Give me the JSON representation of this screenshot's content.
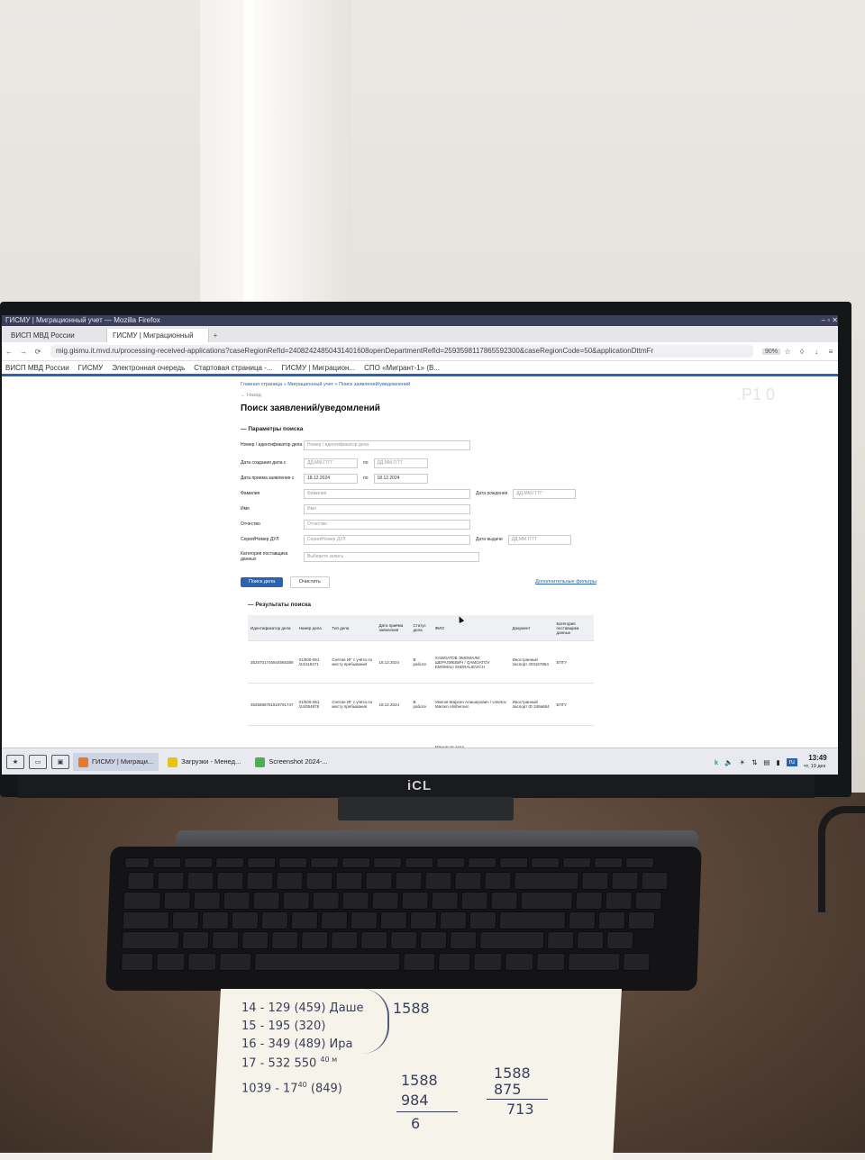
{
  "monitor_brand": "iCL",
  "browser": {
    "window_title": "ГИСМУ | Миграционный учет — Mozilla Firefox",
    "tabs": [
      {
        "label": "ВИСП МВД России",
        "active": false
      },
      {
        "label": "ГИСМУ | Миграционный",
        "active": true
      }
    ],
    "url": "mig.gismu.it.mvd.ru/processing-received-applications?caseRegionRefId=24082424850431401608openDepartmentRefId=2593598117865592300&caseRegionCode=50&applicationDttmFr",
    "zoom": "90%",
    "bookmarks": [
      "ВИСП МВД России",
      "ГИСМУ",
      "Электронная очередь",
      "Стартовая страница -...",
      "ГИСМУ | Миграцион...",
      "СПО «Мигрант-1» (В..."
    ]
  },
  "page": {
    "breadcrumbs": "Главная страница » Миграционный учет » Поиск заявлений/уведомлений",
    "back": "← Назад",
    "title": "Поиск заявлений/уведомлений",
    "params_section": "Параметры поиска",
    "fields": {
      "case_id_label": "Номер / идентификатор дела",
      "case_id_placeholder": "Номер / идентификатор дела",
      "created_label": "Дата создания дела с",
      "date_placeholder": "ДД.ММ.ГГГГ",
      "po": "по",
      "received_label": "Дата приема заявления с",
      "received_from": "18.12.2024",
      "received_to": "18.12.2024",
      "surname_label": "Фамилия",
      "surname_placeholder": "Фамилия",
      "birth_label": "Дата рождения",
      "name_label": "Имя",
      "name_placeholder": "Имя",
      "patronymic_label": "Отчество",
      "patronymic_placeholder": "Отчество",
      "doc_label": "Серия/Номер ДУЛ",
      "doc_placeholder": "Серия/Номер ДУЛ",
      "issue_label": "Дата выдачи",
      "category_label": "Категория поставщика данных",
      "category_placeholder": "Выберите запись"
    },
    "search_button": "Поиск дела",
    "clear_button": "Очистить",
    "extra_filters": "Дополнительные фильтры",
    "results_section": "Результаты поиска",
    "table": {
      "headers": [
        "Идентификатор дела",
        "Номер дела",
        "Тип дела",
        "Дата приёма заявления",
        "Статус дела",
        "ФИО",
        "Документ",
        "Категория поставщика данных"
      ],
      "rows": [
        [
          "3525701745944565389",
          "01/500-061 /24/119471",
          "Снятие ИГ с учёта по месту пребывания",
          "18.12.2024",
          "В работе",
          "ХАМОАТОВ ЭМОМАЛИ ШЕРАЛИЕВИЧ / QAMOATOV EMOMALI SHERALIEVICH",
          "Иностранный паспорт 403167854",
          "ЕПГУ"
        ],
        [
          "3525688761819791747",
          "01/500-061 /24/054878",
          "Снятие ИГ с учёта по месту пребывания",
          "18.12.2024",
          "В работе",
          "Умегов Марсен Алишерович / Umetov Marsen Alisherovic",
          "Иностранный паспорт ID 349a654",
          "ЕПГУ"
        ]
      ],
      "partial_row_name": "Маньясов Акда"
    }
  },
  "taskbar": {
    "tasks": [
      "ГИСМУ | Миграци...",
      "Загрузки - Менед...",
      "Screenshot 2024-..."
    ],
    "lang": "ru",
    "time": "13:49",
    "date": "чт, 19 дек"
  },
  "notes": {
    "line1": "14 - 129 (459) Даше",
    "line2": "15 - 195 (320)",
    "line3": "16 - 349 (489) Ира",
    "line4": "17 - 532 550",
    "line4_sup": "40 м",
    "sum": "1588",
    "line5": "1039 - 17",
    "line5_sup": "40",
    "line5_tail": "(849)",
    "calc1_top": "1588",
    "calc1_sub": "984",
    "calc1_res": "6",
    "calc2_top": "1588",
    "calc2_sub": "875",
    "calc2_res": "713"
  },
  "colors": {
    "accent": "#2a64b0",
    "taskbar": "#e9eaef",
    "wood": "#594638"
  }
}
